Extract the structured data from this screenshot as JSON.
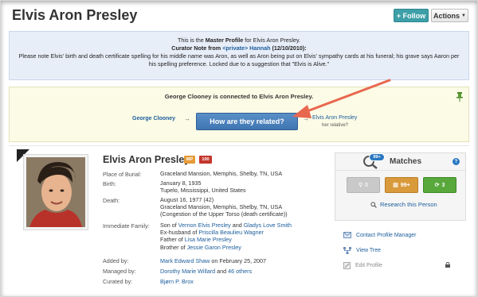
{
  "header": {
    "title": "Elvis Aron Presley",
    "follow_label": "+ Follow",
    "actions_label": "Actions"
  },
  "master_note": {
    "line1_prefix": "This is the ",
    "line1_bold": "Master Profile",
    "line1_suffix": " for Elvis Aron Presley.",
    "curator_prefix": "Curator Note from ",
    "curator_private": "<private>",
    "curator_name": "Hannah",
    "curator_date": " (12/10/2010):",
    "body": "Please note Elvis' birth and death certificate spelling for his middle name was Aron, as well as Aron being put on Elvis' sympathy cards at his funeral; his grave says Aaron per his spelling preference. Locked due to a suggestion that \"Elvis is Alive.\""
  },
  "connection": {
    "title": "George Clooney is connected to Elvis Aron Presley.",
    "left_person": "George Clooney",
    "button_label": "How are they related?",
    "right_person": "Elvis Aron Presley",
    "right_sub": "her relative?"
  },
  "profile": {
    "name": "Elvis Aron Presley",
    "badge_mp": "MP",
    "badge_100": "100",
    "burial_label": "Place of Burial:",
    "burial_value": "Graceland Mansion, Memphis, Shelby, TN, USA",
    "birth_label": "Birth:",
    "birth_date": "January 8, 1935",
    "birth_place": "Tupelo, Mississippi, United States",
    "death_label": "Death:",
    "death_date": "August 16, 1977 (42)",
    "death_place": "Graceland Mansion, Memphis, Shelby, TN, USA",
    "death_cause": "(Congestion of the Upper Torso (death certificate))",
    "family_label": "Immediate Family:",
    "son_of_prefix": "Son of ",
    "father": "Vernon Elvis Presley",
    "and": " and ",
    "mother": "Gladys Love Smith",
    "ex_prefix": "Ex-husband of ",
    "ex_wife": "Priscilla Beaulieu Wagner",
    "father_of_prefix": "Father of ",
    "child": "Lisa Marie Presley",
    "brother_prefix": "Brother of ",
    "sibling": "Jessie Garon Presley",
    "added_label": "Added by:",
    "added_by": "Mark Edward Shaw",
    "added_date": " on February 25, 2007",
    "managed_label": "Managed by:",
    "manager": "Dorothy Marie Willard",
    "managed_and": " and ",
    "others": "46 others",
    "curated_label": "Curated by:",
    "curator": "Bjørn P. Brox"
  },
  "matches": {
    "badge": "99+",
    "title": "Matches",
    "help": "?",
    "grey_count": "0",
    "orange_count": "99+",
    "green_count": "3",
    "research_label": "Research this Person"
  },
  "side_links": {
    "contact": "Contact Profile Manager",
    "tree": "View Tree",
    "edit": "Edit Profile"
  },
  "colors": {
    "follow": "#3d9fa7",
    "related_button": "#4a82bf",
    "link": "#1c5d9c",
    "annotation_arrow": "#e8674f"
  }
}
